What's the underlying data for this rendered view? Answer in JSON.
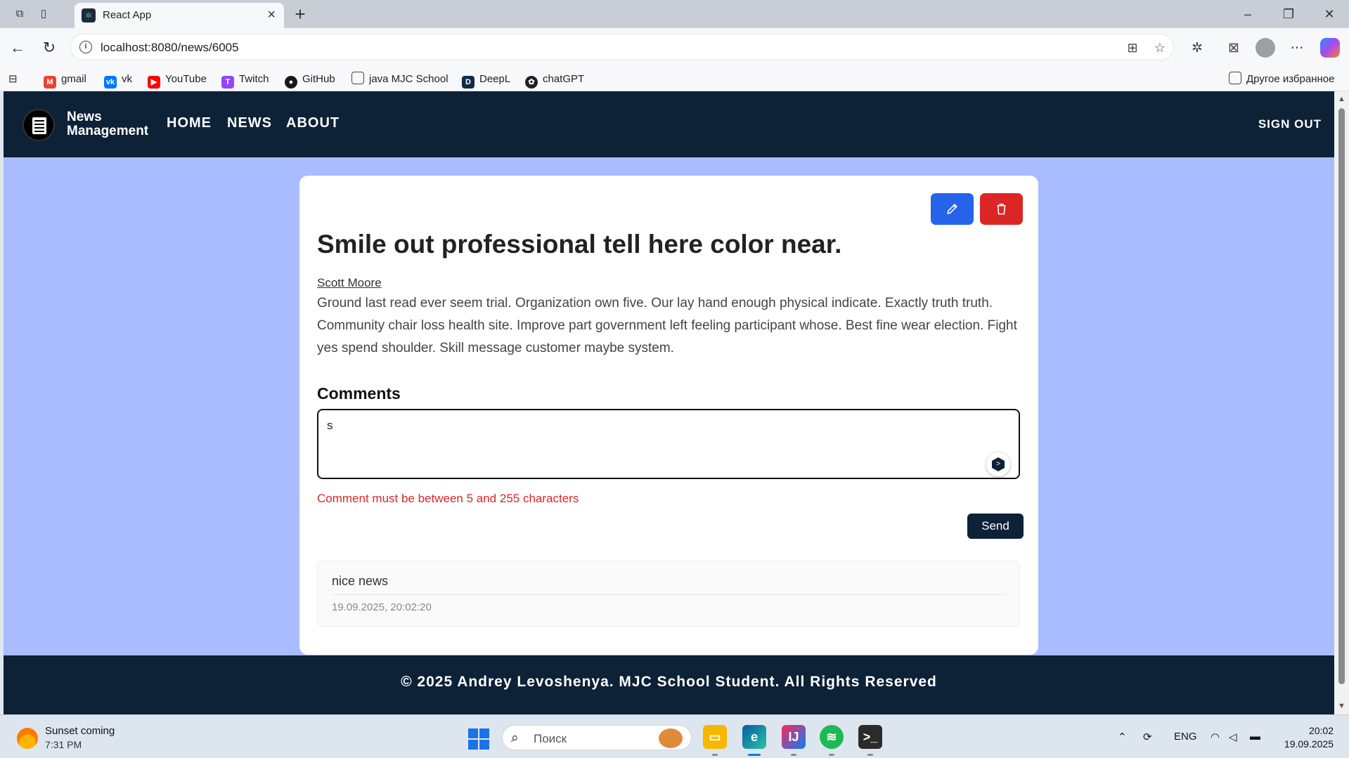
{
  "browser": {
    "tab_title": "React App",
    "url": "localhost:8080/news/6005",
    "bookmarks": [
      {
        "label": "gmail",
        "icon": "gmail-icon",
        "color": "#ea4335"
      },
      {
        "label": "vk",
        "icon": "vk-icon",
        "color": "#0077ff"
      },
      {
        "label": "YouTube",
        "icon": "youtube-icon",
        "color": "#ff0000"
      },
      {
        "label": "Twitch",
        "icon": "twitch-icon",
        "color": "#9146ff"
      },
      {
        "label": "GitHub",
        "icon": "github-icon",
        "color": "#181717"
      },
      {
        "label": "java MJC School",
        "icon": "folder-icon",
        "color": "#444444"
      },
      {
        "label": "DeepL",
        "icon": "deepl-icon",
        "color": "#0f2b46"
      },
      {
        "label": "chatGPT",
        "icon": "chatgpt-icon",
        "color": "#202123"
      }
    ],
    "other_favorites": "Другое избранное"
  },
  "app": {
    "brand_line1": "News",
    "brand_line2": "Management",
    "nav": {
      "home": "HOME",
      "news": "NEWS",
      "about": "ABOUT"
    },
    "sign_out": "SIGN OUT",
    "colors": {
      "header": "#0d2137",
      "background": "#a8bcff",
      "edit": "#2563eb",
      "delete": "#dc2626",
      "error": "#dc2626"
    }
  },
  "article": {
    "title": "Smile out professional tell here color near.",
    "author": "Scott Moore",
    "body": "Ground last read ever seem trial. Organization own five. Our lay hand enough physical indicate. Exactly truth truth. Community chair loss health site. Improve part government left feeling participant whose. Best fine wear election. Fight yes spend shoulder. Skill message customer maybe system."
  },
  "comments": {
    "heading": "Comments",
    "input_value": "s",
    "error": "Comment must be between 5 and 255 characters",
    "send_label": "Send",
    "items": [
      {
        "text": "nice news",
        "date": "19.09.2025, 20:02:20"
      }
    ]
  },
  "footer": {
    "text": "© 2025 Andrey Levoshenya. MJC School Student. All Rights Reserved"
  },
  "taskbar": {
    "weather_title": "Sunset coming",
    "weather_time": "7:31 PM",
    "search_placeholder": "Поиск",
    "lang": "ENG",
    "time": "20:02",
    "date": "19.09.2025"
  }
}
